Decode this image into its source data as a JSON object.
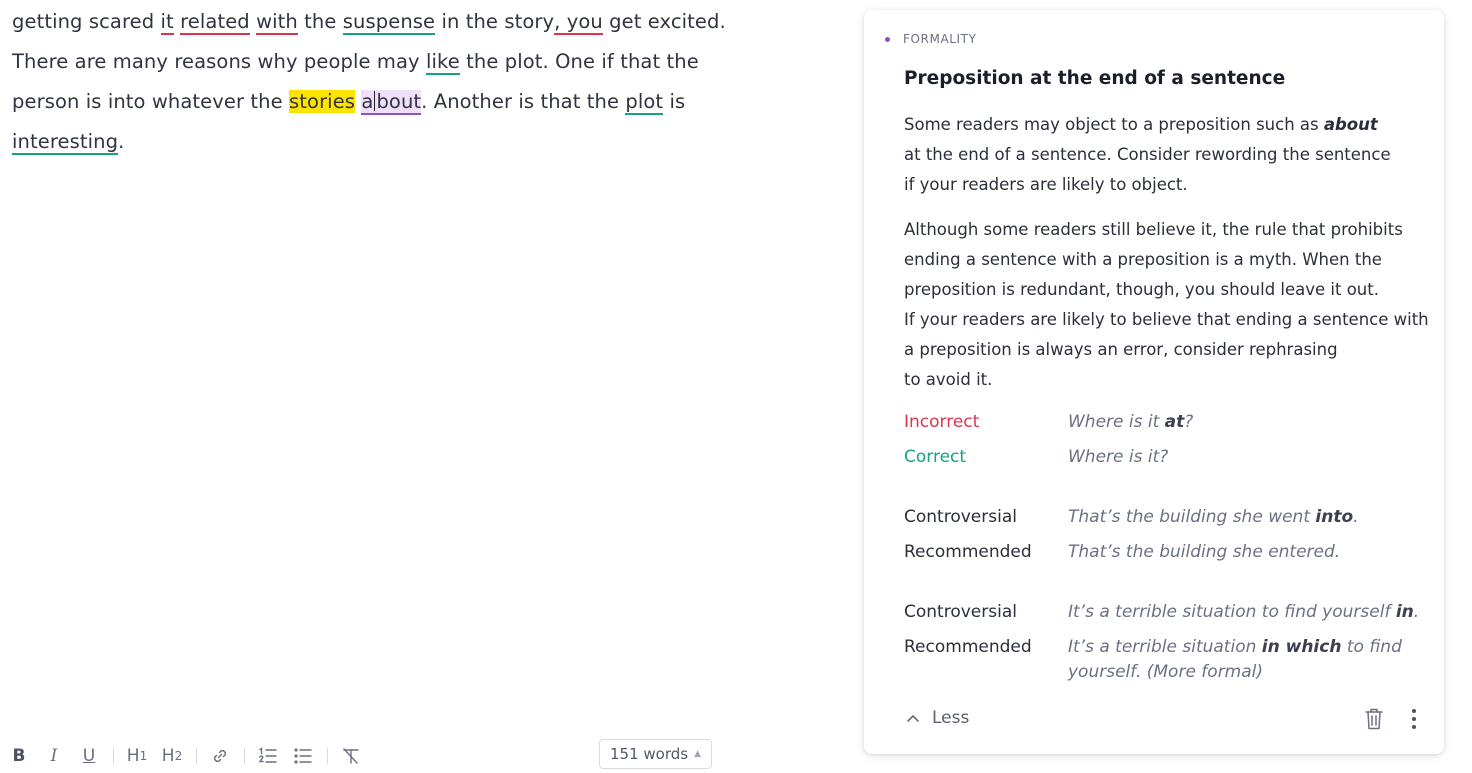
{
  "editor": {
    "line1": {
      "t1": "getting scared ",
      "w_it": "it",
      "t2": " ",
      "w_related": "related",
      "t3": " ",
      "w_with": "with",
      "t4": " the ",
      "w_suspense": "suspense",
      "t5": " in the story",
      "w_you": ", you",
      "t6": " get excited."
    },
    "line2": {
      "t1": "There are many reasons why people may ",
      "w_like": "like",
      "t2": " the plot. One if that the"
    },
    "line3": {
      "t1": "person is into whatever the ",
      "w_stories": "stories",
      "t2": " ",
      "w_about_a": "a",
      "w_about_rest": "bout",
      "t3": ". Another is that the ",
      "w_plot": "plot",
      "t4": " is"
    },
    "line4": {
      "w_interesting": "interesting",
      "t1": "."
    }
  },
  "toolbar": {
    "bold": "B",
    "italic": "I",
    "underline": "U",
    "h1": "H",
    "h1_sub": "1",
    "h2": "H",
    "h2_sub": "2"
  },
  "word_count": "151 words",
  "card": {
    "category": "FORMALITY",
    "title": "Preposition at the end of a sentence",
    "para1": {
      "l1a": "Some readers may object to a preposition such as ",
      "l1b": "about",
      "l2": "at the end of a sentence. Consider rewording the sentence",
      "l3": "if your readers are likely to object."
    },
    "para2": [
      "Although some readers still believe it, the rule that prohibits",
      "ending a sentence with a preposition is a myth. When the",
      "preposition is redundant, though, you should leave it out.",
      "If your readers are likely to believe that ending a sentence with",
      "a preposition is always an error, consider rephrasing",
      "to avoid it."
    ],
    "examples": {
      "ex1_label": "Incorrect",
      "ex1_a": "Where is it ",
      "ex1_b": "at",
      "ex1_c": "?",
      "ex2_label": "Correct",
      "ex2_text": "Where is it?",
      "ex3_label": "Controversial",
      "ex3_a": "That’s the building she went ",
      "ex3_b": "into",
      "ex3_c": ".",
      "ex4_label": "Recommended",
      "ex4_text": "That’s the building she entered.",
      "ex5_label": "Controversial",
      "ex5_a": "It’s a terrible situation to find yourself ",
      "ex5_b": "in",
      "ex5_c": ".",
      "ex6_label": "Recommended",
      "ex6_a": "It’s a terrible situation ",
      "ex6_b": "in which",
      "ex6_c": " to find",
      "ex6_d": "yourself. (More formal)"
    },
    "less_label": "Less"
  },
  "colors": {
    "incorrect": "#d8354f",
    "correct": "#15a381",
    "formality_accent": "#8c52c8",
    "highlight_yellow": "#fce400"
  },
  "icons": [
    "bold-icon",
    "italic-icon",
    "underline-icon",
    "h1-icon",
    "h2-icon",
    "link-icon",
    "numbered-list-icon",
    "bullet-list-icon",
    "clear-format-icon",
    "chevron-up-icon",
    "trash-icon",
    "more-vertical-icon"
  ]
}
